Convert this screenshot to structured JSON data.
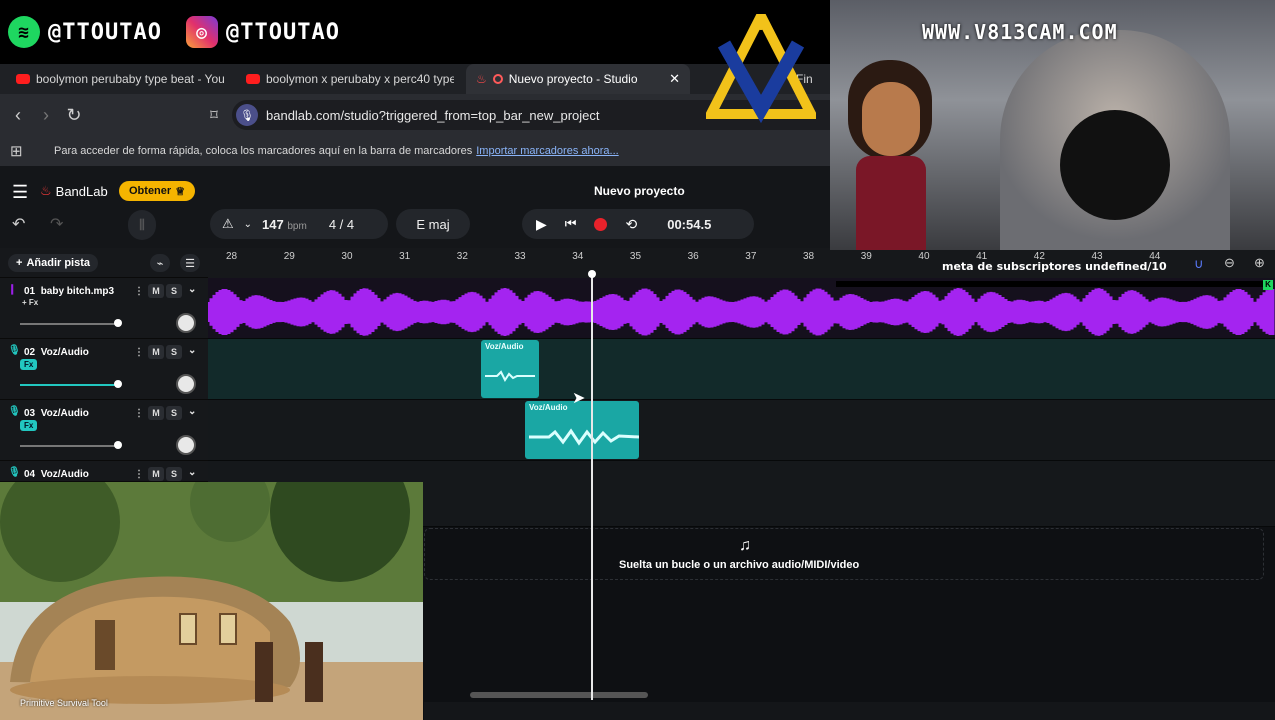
{
  "overlay": {
    "social_left": "@TTOUTAO",
    "social_right": "@TTOUTAO",
    "webcam_watermark": "WWW.V813CAM.COM",
    "subscriber_goal": "meta de subscriptores undefined/10",
    "video_caption": "Primitive Survival Tool"
  },
  "browser": {
    "tabs": [
      {
        "label": "boolymon perubaby type beat - YouT",
        "icon": "youtube-icon"
      },
      {
        "label": "boolymon x perubaby x perc40 type",
        "icon": "youtube-icon"
      },
      {
        "label": "Nuevo proyecto - Studio",
        "icon": "bandlab-icon",
        "active": true
      },
      {
        "label": "Fin",
        "icon": "tab-icon"
      }
    ],
    "url": "bandlab.com/studio?triggered_from=top_bar_new_project",
    "bookmarks_hint": "Para acceder de forma rápida, coloca los marcadores aquí en la barra de marcadores",
    "bookmarks_link": "Importar marcadores ahora..."
  },
  "app": {
    "logo": "BandLab",
    "upgrade_label": "Obtener",
    "project_title": "Nuevo proyecto",
    "tempo": "147",
    "tempo_unit": "bpm",
    "time_signature": "4 / 4",
    "key": "E maj",
    "time": "00:54.5",
    "add_track": "Añadir pista",
    "drop_hint": "Suelta un bucle o un archivo audio/MIDI/video",
    "ruler": [
      "28",
      "29",
      "30",
      "31",
      "32",
      "33",
      "34",
      "35",
      "36",
      "37",
      "38",
      "39",
      "40",
      "41",
      "42",
      "43",
      "44"
    ],
    "tracks": [
      {
        "num": "01",
        "name": "baby bitch.mp3",
        "fx": "+ Fx",
        "color": "#9b1fe8"
      },
      {
        "num": "02",
        "name": "Voz/Audio",
        "fx": "Fx",
        "color": "#22c7c0"
      },
      {
        "num": "03",
        "name": "Voz/Audio",
        "fx": "Fx",
        "color": "#22c7c0"
      },
      {
        "num": "04",
        "name": "Voz/Audio",
        "fx": "",
        "color": "#22c7c0"
      }
    ],
    "clips": [
      {
        "track": 2,
        "label": "Voz/Audio"
      },
      {
        "track": 3,
        "label": "Voz/Audio"
      }
    ],
    "mute_label": "M",
    "solo_label": "S"
  }
}
